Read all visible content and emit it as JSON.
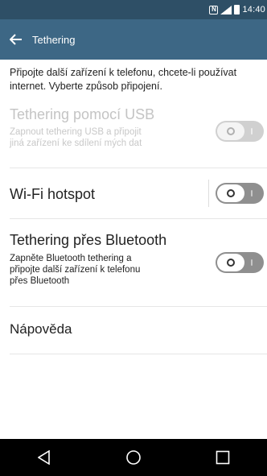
{
  "status_bar": {
    "time": "14:40",
    "icons": [
      "nfc-icon",
      "signal-icon",
      "battery-icon"
    ]
  },
  "app_bar": {
    "title": "Tethering",
    "back_icon": "arrow-back-icon"
  },
  "intro_text": "Připojte další zařízení k telefonu, chcete-li používat internet. Vyberte způsob připojení.",
  "settings": {
    "usb": {
      "title": "Tethering pomocí USB",
      "subtitle_line1": "Zapnout tethering USB a připojit",
      "subtitle_line2": "jiná zařízení ke sdílení mých dat",
      "enabled": false,
      "state": "off"
    },
    "wifi": {
      "title": "Wi-Fi hotspot",
      "state": "off"
    },
    "bluetooth": {
      "title": "Tethering přes Bluetooth",
      "subtitle_line1": "Zapněte Bluetooth tethering a",
      "subtitle_line2": "připojte další zařízení k telefonu",
      "subtitle_line3": "přes Bluetooth",
      "state": "off"
    },
    "help": {
      "label": "Nápověda"
    }
  },
  "nav_bar": {
    "buttons": [
      "back-triangle-icon",
      "home-circle-icon",
      "recents-square-icon"
    ]
  },
  "colors": {
    "status_bar": "#2e4f66",
    "app_bar": "#3d6785",
    "toggle_off": "#8f8f8f",
    "nav_bar": "#000000"
  }
}
